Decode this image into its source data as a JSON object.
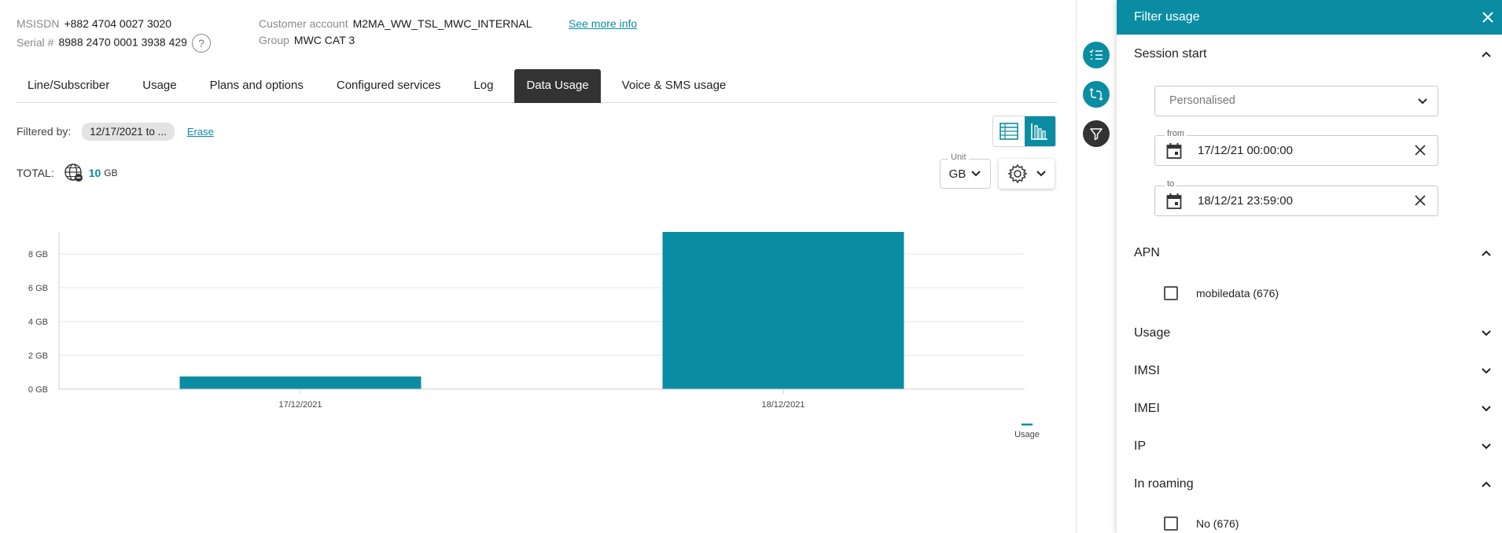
{
  "header": {
    "msisdn_label": "MSISDN",
    "msisdn_value": "+882 4704 0027 3020",
    "serial_label": "Serial #",
    "serial_value": "8988 2470 0001 3938 429",
    "help_glyph": "?",
    "customer_label": "Customer account",
    "customer_value": "M2MA_WW_TSL_MWC_INTERNAL",
    "group_label": "Group",
    "group_value": "MWC CAT 3",
    "see_more": "See more info"
  },
  "tabs": [
    {
      "label": "Line/Subscriber",
      "active": false
    },
    {
      "label": "Usage",
      "active": false
    },
    {
      "label": "Plans and options",
      "active": false
    },
    {
      "label": "Configured services",
      "active": false
    },
    {
      "label": "Log",
      "active": false
    },
    {
      "label": "Data Usage",
      "active": true
    },
    {
      "label": "Voice & SMS usage",
      "active": false
    }
  ],
  "filter": {
    "label": "Filtered by:",
    "chip": "12/17/2021 to ...",
    "erase": "Erase"
  },
  "total": {
    "label": "TOTAL:",
    "value": "10",
    "unit": "GB"
  },
  "unit_select": {
    "caption": "Unit",
    "value": "GB"
  },
  "icons": {
    "table_view": "table-icon",
    "chart_view": "bar-chart-icon",
    "total": "globe-icon",
    "settings": "gear-icon",
    "rail_list": "list-icon",
    "rail_swap": "swap-icon",
    "rail_filter": "filter-icon",
    "calendar": "calendar-icon",
    "close": "close-icon"
  },
  "colors": {
    "accent": "#0a8da3",
    "tab_active": "#333333",
    "rail_filter": "#333333"
  },
  "chart_data": {
    "type": "bar",
    "categories": [
      "17/12/2021",
      "18/12/2021"
    ],
    "series": [
      {
        "name": "Usage",
        "values": [
          0.75,
          9.3
        ]
      }
    ],
    "unit": "GB",
    "yticks": [
      0,
      2,
      4,
      6,
      8
    ],
    "ytick_labels": [
      "0 GB",
      "2 GB",
      "4 GB",
      "6 GB",
      "8 GB"
    ],
    "ylim": [
      0,
      9.3
    ],
    "grid": true,
    "legend": "bottom-right",
    "color": "#0a8da3"
  },
  "panel": {
    "title": "Filter usage",
    "session_start": {
      "title": "Session start",
      "select_value": "Personalised",
      "from_caption": "from",
      "from_value": "17/12/21 00:00:00",
      "to_caption": "to",
      "to_value": "18/12/21 23:59:00"
    },
    "apn": {
      "title": "APN",
      "options": [
        {
          "label": "mobiledata (676)",
          "checked": false
        }
      ]
    },
    "usage_title": "Usage",
    "imsi_title": "IMSI",
    "imei_title": "IMEI",
    "ip_title": "IP",
    "roaming": {
      "title": "In roaming",
      "options": [
        {
          "label": "No (676)",
          "checked": false
        }
      ]
    }
  }
}
